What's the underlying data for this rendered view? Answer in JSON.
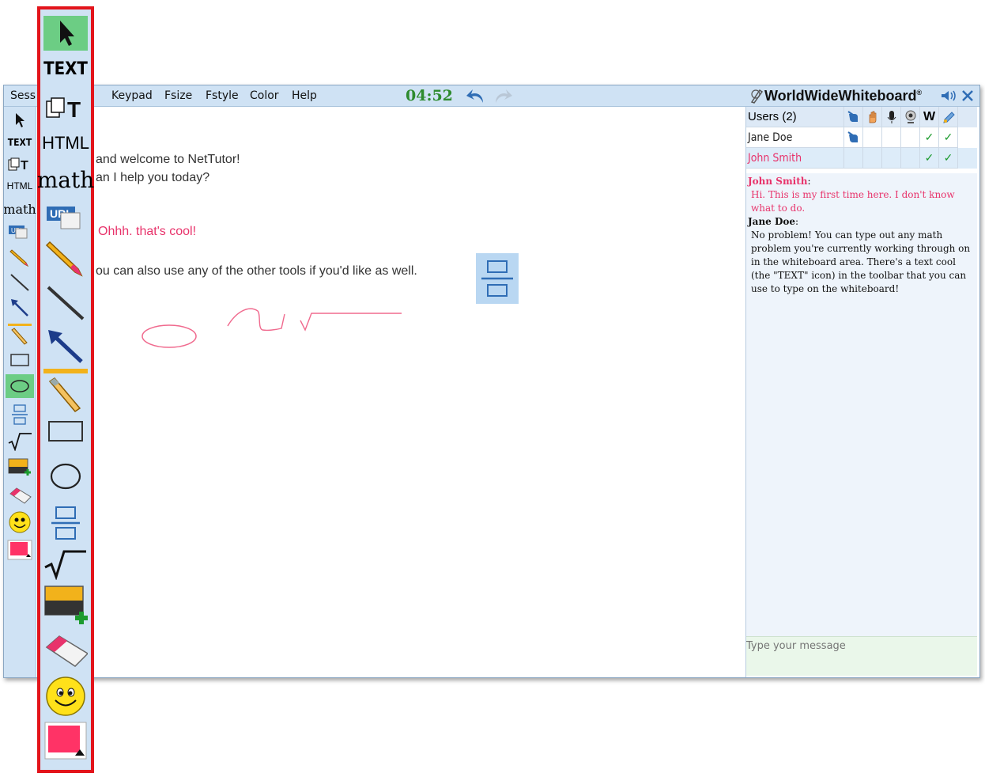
{
  "menubar": {
    "session_label": "Sess",
    "items": [
      "Keypad",
      "Fsize",
      "Fstyle",
      "Color",
      "Help"
    ],
    "timer": "04:52",
    "brand": "WorldWideWhiteboard",
    "brand_mark": "®"
  },
  "left_toolbar": {
    "tools": [
      "pointer-tool",
      "TEXT",
      "paste-text",
      "HTML",
      "math",
      "URL",
      "pencil",
      "line",
      "arrow",
      "highlighter",
      "rectangle",
      "ellipse",
      "fraction",
      "square-root",
      "insert-image",
      "eraser",
      "smiley",
      "color-picker"
    ],
    "text_labels": {
      "text": "TEXT",
      "html": "HTML",
      "math": "math",
      "url": "URL"
    },
    "selected_tool": "ellipse"
  },
  "big_toolbar": {
    "text_labels": {
      "text": "TEXT",
      "html": "HTML",
      "math": "math",
      "url": "URL"
    }
  },
  "canvas": {
    "line1": "and welcome to NetTutor!",
    "line2": "an I help you today?",
    "line3": "Ohhh. that's cool!",
    "line4": "ou can also use any of the other tools if you'd like as well."
  },
  "users": {
    "header": "Users (2)",
    "w_header": "W",
    "rows": [
      {
        "name": "Jane Doe",
        "color": "#222222",
        "check1": "✓",
        "check2": "✓"
      },
      {
        "name": "John Smith",
        "color": "#e8336b",
        "check1": "✓",
        "check2": "✓"
      }
    ]
  },
  "chat": {
    "messages": [
      {
        "name": "John Smith",
        "sep": ":",
        "text": "Hi. This is my first time here. I don't know what to do.",
        "color": "#e8336b"
      },
      {
        "name": "Jane Doe",
        "sep": ":",
        "text": "No problem! You can type out any math problem you're currently working through on in the whiteboard area. There's a text cool (the \"TEXT\" icon) in the toolbar that you can use to type on the whiteboard!",
        "color": "#111111"
      }
    ],
    "placeholder": "Type your message"
  },
  "colors": {
    "accent": "#e8336b",
    "toolbar_bg": "#cfe2f4",
    "highlight_border": "#e3141b",
    "timer": "#2e8b2e"
  }
}
